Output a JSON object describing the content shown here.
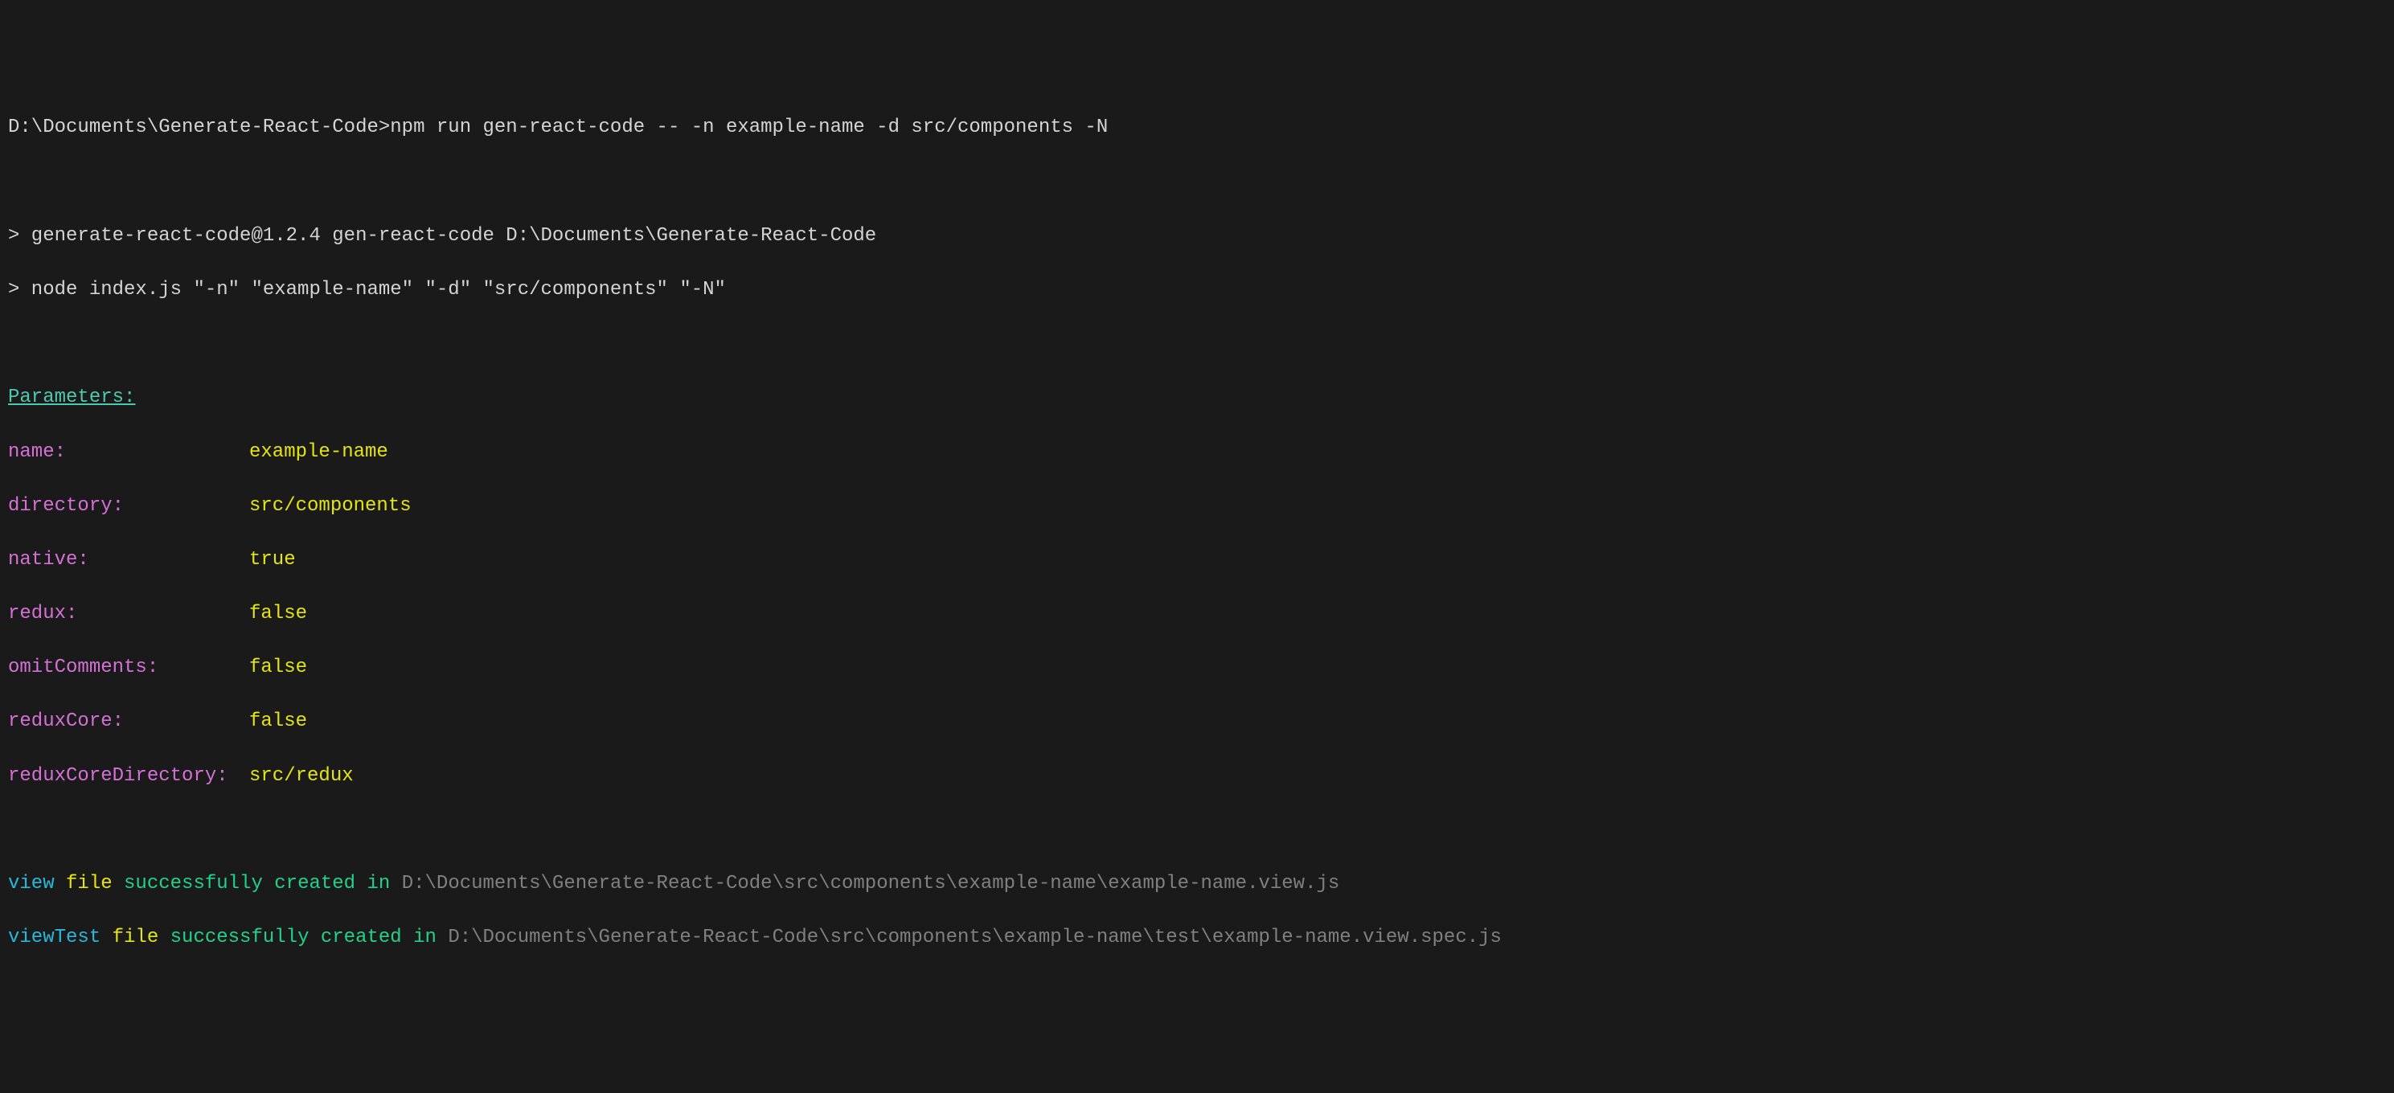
{
  "command": {
    "prompt": "D:\\Documents\\Generate-React-Code>",
    "text": "npm run gen-react-code -- -n example-name -d src/components -N"
  },
  "output": {
    "line1": "> generate-react-code@1.2.4 gen-react-code D:\\Documents\\Generate-React-Code",
    "line2": "> node index.js \"-n\" \"example-name\" \"-d\" \"src/components\" \"-N\""
  },
  "parametersHeader": "Parameters:",
  "parameters": [
    {
      "label": "name:",
      "value": "example-name"
    },
    {
      "label": "directory:",
      "value": "src/components"
    },
    {
      "label": "native:",
      "value": "true"
    },
    {
      "label": "redux:",
      "value": "false"
    },
    {
      "label": "omitComments:",
      "value": "false"
    },
    {
      "label": "reduxCore:",
      "value": "false"
    },
    {
      "label": "reduxCoreDirectory:",
      "value": "src/redux"
    }
  ],
  "results": [
    {
      "type": "view",
      "fileWord": "file",
      "successText": "successfully created in",
      "path": "D:\\Documents\\Generate-React-Code\\src\\components\\example-name\\example-name.view.js"
    },
    {
      "type": "viewTest",
      "fileWord": "file",
      "successText": "successfully created in",
      "path": "D:\\Documents\\Generate-React-Code\\src\\components\\example-name\\test\\example-name.view.spec.js"
    }
  ]
}
